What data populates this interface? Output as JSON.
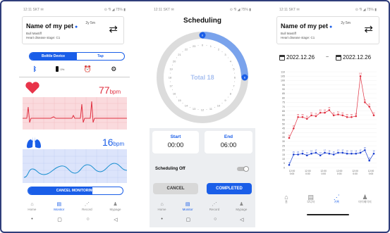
{
  "status": {
    "time": "12:11 SKT ✉",
    "icons": "⊙ ⅋ ◢ 75% ▮",
    "time2": "12:11 SKT ✉",
    "icons2": "⊙ ⅋ ◢ 75% ▮",
    "time3": "12:11 SKT ✉",
    "icons3": "⊙ ⅋ ◢ 75% ▮"
  },
  "pet": {
    "name": "Name of my pet",
    "breed": "Bull Mastiff",
    "stage": "Heart disease stage: C1",
    "age": "2y 5m"
  },
  "monitor": {
    "seg_active": "Bolttle Device",
    "seg_inactive": "Tap",
    "battery_pct": "0%",
    "heart_value": "77",
    "heart_unit": "bpm",
    "resp_value": "16",
    "resp_unit": "bpm",
    "cancel_label": "CANCEL MONITORING",
    "colors": {
      "heart": "#e8344a",
      "lungs": "#1a5ee8",
      "heart_bg": "#fadadd",
      "resp_bg": "#dce4fb"
    }
  },
  "nav1": [
    {
      "label": "Home",
      "icon": "home-icon"
    },
    {
      "label": "Monitor",
      "icon": "monitor-icon"
    },
    {
      "label": "Record",
      "icon": "record-icon"
    },
    {
      "label": "Mypage",
      "icon": "person-icon"
    }
  ],
  "scheduling": {
    "title": "Scheduling",
    "total_label": "Total 18",
    "clock_ticks": [
      "0",
      "1",
      "2",
      "3",
      "4",
      "5",
      "6",
      "7",
      "8",
      "9",
      "10",
      "11",
      "12",
      "13",
      "14",
      "15",
      "16",
      "17",
      "18",
      "19",
      "20",
      "21",
      "22",
      "23"
    ],
    "handle_start": "0",
    "handle_end": "6",
    "start_label": "Start",
    "start_time": "00:00",
    "end_label": "End",
    "end_time": "06:00",
    "toggle_label": "Scheduling Off",
    "cancel_label": "CANCEL",
    "completed_label": "COMPLETED"
  },
  "nav2": [
    {
      "label": "Home",
      "icon": "home-icon"
    },
    {
      "label": "Monitor",
      "icon": "monitor-icon"
    },
    {
      "label": "Record",
      "icon": "record-icon"
    },
    {
      "label": "Mypage",
      "icon": "person-icon"
    }
  ],
  "record": {
    "date_from": "2022.12.26",
    "date_sep": "~",
    "date_to": "2022.12.26",
    "yticks": [
      "110",
      "105",
      "100",
      "95",
      "90",
      "85",
      "80",
      "75",
      "70",
      "65",
      "60",
      "55",
      "50",
      "45",
      "40",
      "35",
      "30",
      "25",
      "20",
      "15",
      "10",
      "5",
      "0"
    ],
    "xticks": [
      "12:00\n0:00",
      "12:00\n0:00",
      "12:00\n0:00",
      "12:00\n0:00",
      "12:00\n0:00",
      "12:00\n0:00"
    ]
  },
  "chart_data": {
    "type": "line",
    "ylim": [
      0,
      110
    ],
    "series": [
      {
        "color": "#e03040",
        "values": [
          34,
          45,
          58,
          58,
          56,
          60,
          59,
          63,
          63,
          66,
          60,
          61,
          60,
          58,
          58,
          59,
          105,
          75,
          70,
          60
        ]
      },
      {
        "color": "#1a3fd0",
        "values": [
          3,
          15,
          15,
          16,
          14,
          16,
          17,
          14,
          17,
          16,
          15,
          17,
          17,
          16,
          16,
          16,
          17,
          20,
          8,
          16
        ]
      }
    ]
  },
  "nav3": [
    {
      "label": "홈",
      "icon": "home-icon"
    },
    {
      "label": "모니터",
      "icon": "monitor-icon"
    },
    {
      "label": "기록",
      "icon": "record-icon"
    },
    {
      "label": "마이페이지",
      "icon": "person-icon"
    }
  ]
}
